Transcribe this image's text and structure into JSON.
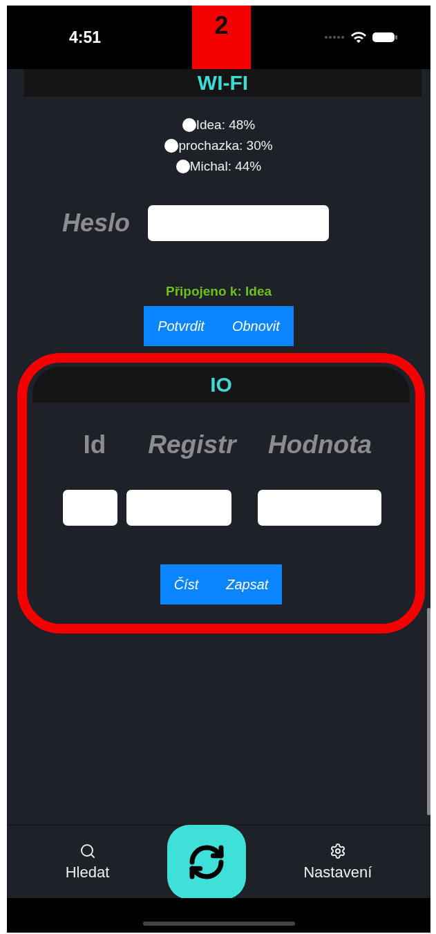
{
  "status_bar": {
    "time": "4:51"
  },
  "annotation_badge": "2",
  "wifi": {
    "title": "WI-FI",
    "networks": [
      {
        "label": "Idea: 48%"
      },
      {
        "label": "prochazka: 30%"
      },
      {
        "label": "Michal: 44%"
      }
    ],
    "password_label": "Heslo",
    "connection_status": "Připojeno k: Idea",
    "buttons": [
      "Potvrdit",
      "Obnovit"
    ]
  },
  "io": {
    "title": "IO",
    "columns": [
      "Id",
      "Registr",
      "Hodnota"
    ],
    "buttons": [
      "Číst",
      "Zapsat"
    ]
  },
  "tab_bar": {
    "items": [
      {
        "kind": "search",
        "label": "Hledat"
      },
      {
        "kind": "sync"
      },
      {
        "kind": "settings",
        "label": "Nastavení"
      }
    ]
  }
}
